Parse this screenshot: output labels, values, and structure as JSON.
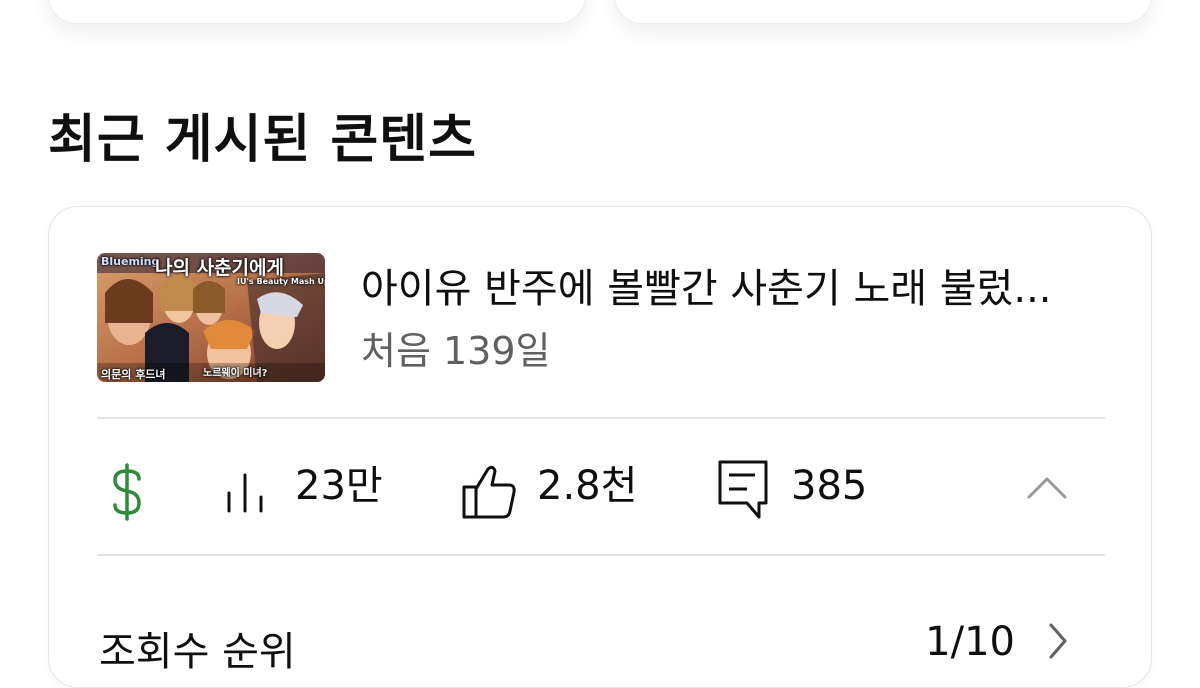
{
  "section": {
    "title": "최근 게시된 콘텐츠"
  },
  "video": {
    "thumbnail": {
      "top_text": "Blueming",
      "title_text": "나의 사춘기에게",
      "sub_text": "IU's Beauty Mash Up",
      "caption_left": "의문의 후드녀",
      "caption_right": "노르웨이 미녀?"
    },
    "title": "아이유 반주에 볼빨간 사춘기 노래 불렀...",
    "meta": "처음 139일"
  },
  "stats": {
    "revenue_icon": "dollar-icon",
    "views": "23만",
    "likes": "2.8천",
    "comments": "385"
  },
  "ranking": {
    "label": "조회수 순위",
    "value": "1/10"
  },
  "colors": {
    "revenue": "#2e8b3a",
    "meta": "#606060",
    "divider": "#e3e3e3"
  }
}
